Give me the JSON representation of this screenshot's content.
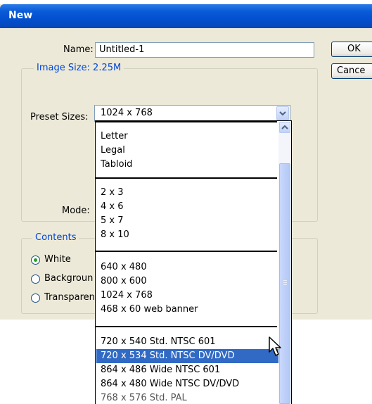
{
  "window": {
    "title": "New"
  },
  "name_field": {
    "label": "Name:",
    "value": "Untitled-1"
  },
  "buttons": {
    "ok": "OK",
    "cancel": "Cance"
  },
  "image_size": {
    "label": "Image Size: 2.25M"
  },
  "preset": {
    "label": "Preset Sizes:",
    "value": "1024 x 768"
  },
  "mode": {
    "label": "Mode:"
  },
  "contents": {
    "legend": "Contents",
    "options": [
      {
        "label": "White",
        "selected": true
      },
      {
        "label": "Backgroun",
        "selected": false
      },
      {
        "label": "Transparen",
        "selected": false
      }
    ]
  },
  "dropdown": {
    "groups": [
      [
        "Letter",
        "Legal",
        "Tabloid"
      ],
      [
        "2 x 3",
        "4 x 6",
        "5 x 7",
        "8 x 10"
      ],
      [
        "640 x 480",
        "800 x 600",
        "1024 x 768",
        "468 x 60 web banner"
      ],
      [
        "720 x 540 Std. NTSC 601",
        "720 x 534 Std. NTSC DV/DVD",
        "864 x 486 Wide NTSC 601",
        "864 x 480 Wide NTSC DV/DVD",
        "768 x 576 Std. PAL"
      ]
    ],
    "highlighted": "720 x 534 Std. NTSC DV/DVD"
  },
  "colors": {
    "accent": "#316ac5",
    "title_bar": "#0a5bd8",
    "legend_text": "#0046d5",
    "dialog_bg": "#ece9d8"
  }
}
